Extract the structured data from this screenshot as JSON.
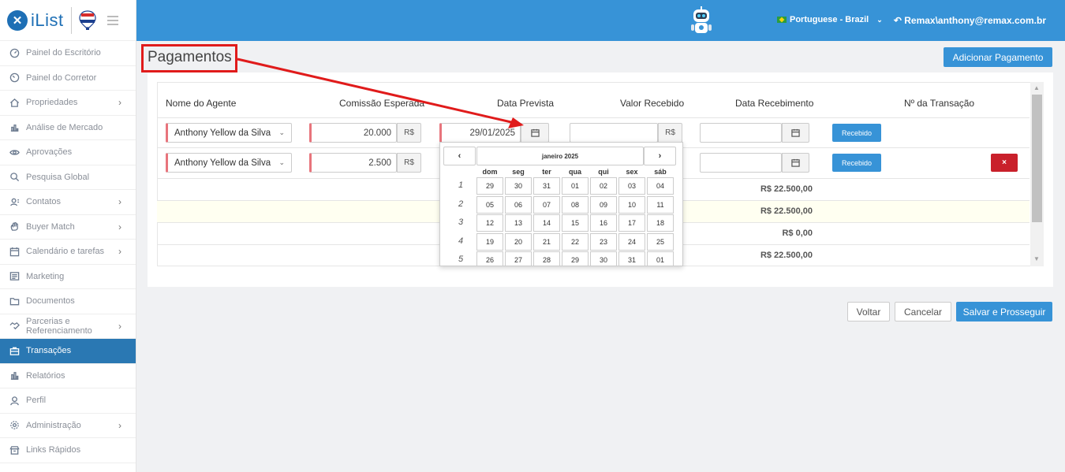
{
  "brand": {
    "name": "iList",
    "logo_letter": "✕"
  },
  "sidebar": {
    "items": [
      {
        "label": "Painel do Escritório",
        "icon": "dashboard-icon",
        "chevron": false
      },
      {
        "label": "Painel do Corretor",
        "icon": "gauge-icon",
        "chevron": false
      },
      {
        "label": "Propriedades",
        "icon": "home-icon",
        "chevron": true
      },
      {
        "label": "Análise de Mercado",
        "icon": "bar-chart-icon",
        "chevron": false
      },
      {
        "label": "Aprovações",
        "icon": "eye-icon",
        "chevron": false
      },
      {
        "label": "Pesquisa Global",
        "icon": "search-icon",
        "chevron": false
      },
      {
        "label": "Contatos",
        "icon": "contacts-icon",
        "chevron": true
      },
      {
        "label": "Buyer Match",
        "icon": "hand-icon",
        "chevron": true
      },
      {
        "label": "Calendário e tarefas",
        "icon": "calendar-icon",
        "chevron": true
      },
      {
        "label": "Marketing",
        "icon": "newspaper-icon",
        "chevron": false
      },
      {
        "label": "Documentos",
        "icon": "folder-icon",
        "chevron": false
      },
      {
        "label": "Parcerias e Referenciamento",
        "icon": "handshake-icon",
        "chevron": true
      },
      {
        "label": "Transações",
        "icon": "briefcase-icon",
        "chevron": false,
        "active": true
      },
      {
        "label": "Relatórios",
        "icon": "report-icon",
        "chevron": false
      },
      {
        "label": "Perfil",
        "icon": "user-icon",
        "chevron": false
      },
      {
        "label": "Administração",
        "icon": "gear-icon",
        "chevron": true
      },
      {
        "label": "Links Rápidos",
        "icon": "store-icon",
        "chevron": false
      }
    ]
  },
  "topbar": {
    "language": "Portuguese - Brazil",
    "user": "Remax\\anthony@remax.com.br"
  },
  "page": {
    "title": "Pagamentos",
    "add_button": "Adicionar Pagamento",
    "back_button": "Voltar",
    "cancel_button": "Cancelar",
    "save_button": "Salvar e Prosseguir"
  },
  "table": {
    "headers": [
      "Nome do Agente",
      "Comissão Esperada",
      "Data Prevista",
      "Valor Recebido",
      "Data Recebimento",
      "Nº da Transação"
    ],
    "currency": "R$",
    "rows": [
      {
        "agent": "Anthony Yellow da Silva",
        "commission": "20.000",
        "expected_date": "29/01/2025",
        "received_value": "",
        "received_date": "",
        "status_button": "Recebido"
      },
      {
        "agent": "Anthony Yellow da Silva",
        "commission": "2.500",
        "expected_date": "",
        "received_value": "",
        "received_date": "",
        "status_button": "Recebido",
        "delete_button": "×"
      }
    ],
    "totals": [
      "R$ 22.500,00",
      "R$ 22.500,00",
      "R$ 0,00",
      "R$ 22.500,00"
    ]
  },
  "datepicker": {
    "month_label": "janeiro 2025",
    "prev": "‹",
    "next": "›",
    "weekdays": [
      "dom",
      "seg",
      "ter",
      "qua",
      "qui",
      "sex",
      "sáb"
    ],
    "weeks": [
      {
        "num": "1",
        "days": [
          "29",
          "30",
          "31",
          "01",
          "02",
          "03",
          "04"
        ]
      },
      {
        "num": "2",
        "days": [
          "05",
          "06",
          "07",
          "08",
          "09",
          "10",
          "11"
        ]
      },
      {
        "num": "3",
        "days": [
          "12",
          "13",
          "14",
          "15",
          "16",
          "17",
          "18"
        ]
      },
      {
        "num": "4",
        "days": [
          "19",
          "20",
          "21",
          "22",
          "23",
          "24",
          "25"
        ]
      },
      {
        "num": "5",
        "days": [
          "26",
          "27",
          "28",
          "29",
          "30",
          "31",
          "01"
        ]
      }
    ]
  },
  "colors": {
    "primary": "#3793d7",
    "active_nav": "#2a78b3",
    "annotation": "#e01b1b",
    "danger": "#c9202b"
  }
}
